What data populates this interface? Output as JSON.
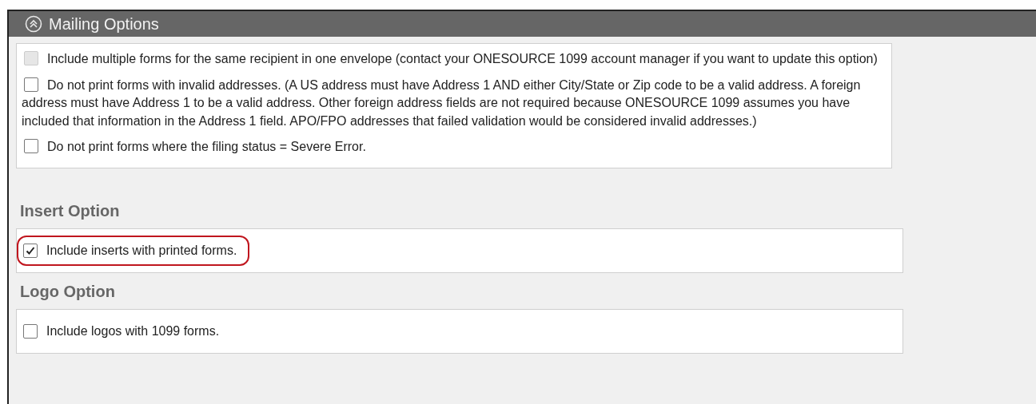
{
  "panel": {
    "title": "Mailing Options",
    "expanded": true
  },
  "mailing_options": [
    {
      "label": "Include multiple forms for the same recipient in one envelope (contact your ONESOURCE 1099 account manager if you want to update this option)",
      "checked": false,
      "disabled": true
    },
    {
      "label": "Do not print forms with invalid addresses. (A US address must have Address 1 AND either City/State or Zip code to be a valid address. A foreign address must have Address 1 to be a valid address. Other foreign address fields are not required because ONESOURCE 1099 assumes you have included that information in the Address 1 field. APO/FPO addresses that failed validation would be considered invalid addresses.)",
      "checked": false,
      "disabled": false
    },
    {
      "label": "Do not print forms where the filing status = Severe Error.",
      "checked": false,
      "disabled": false
    }
  ],
  "sections": [
    {
      "heading": "Insert Option",
      "options": [
        {
          "label": "Include inserts with printed forms.",
          "checked": true,
          "highlighted": true
        }
      ]
    },
    {
      "heading": "Logo Option",
      "options": [
        {
          "label": "Include logos with 1099 forms.",
          "checked": false,
          "highlighted": false
        }
      ]
    }
  ]
}
